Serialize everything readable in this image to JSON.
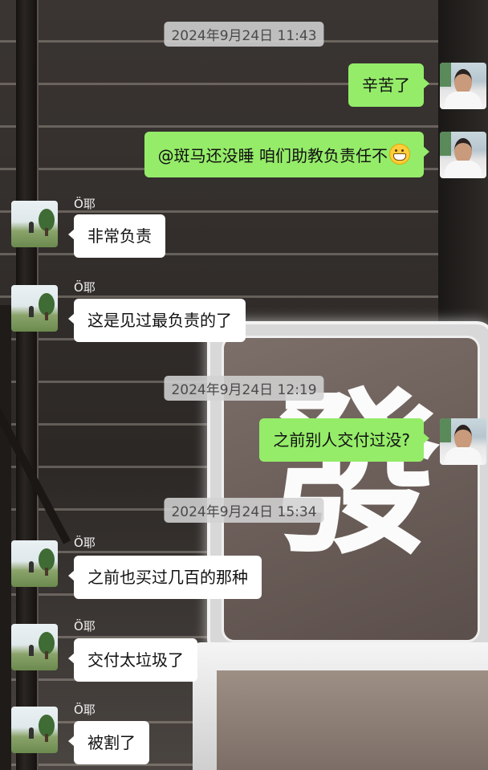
{
  "chat": {
    "timestamps": [
      "2024年9月24日 11:43",
      "2024年9月24日 12:19",
      "2024年9月24日 15:34"
    ],
    "contact_name": "Ö耶",
    "messages": [
      {
        "from": "me",
        "text": "辛苦了"
      },
      {
        "from": "me",
        "text": "@斑马还没睡 咱们助教负责任不",
        "emoji": "grinning-face-emoji"
      },
      {
        "from": "other",
        "text": "非常负责"
      },
      {
        "from": "other",
        "text": "这是见过最负责的了"
      },
      {
        "from": "me",
        "text": "之前别人交付过没?"
      },
      {
        "from": "other",
        "text": "之前也买过几百的那种"
      },
      {
        "from": "other",
        "text": "交付太垃圾了"
      },
      {
        "from": "other",
        "text": "被割了"
      }
    ]
  },
  "background": {
    "tile_glyph": "發"
  },
  "colors": {
    "my_bubble": "#95ec69",
    "other_bubble": "#ffffff",
    "timestamp_bg": "#d2d2d2"
  }
}
